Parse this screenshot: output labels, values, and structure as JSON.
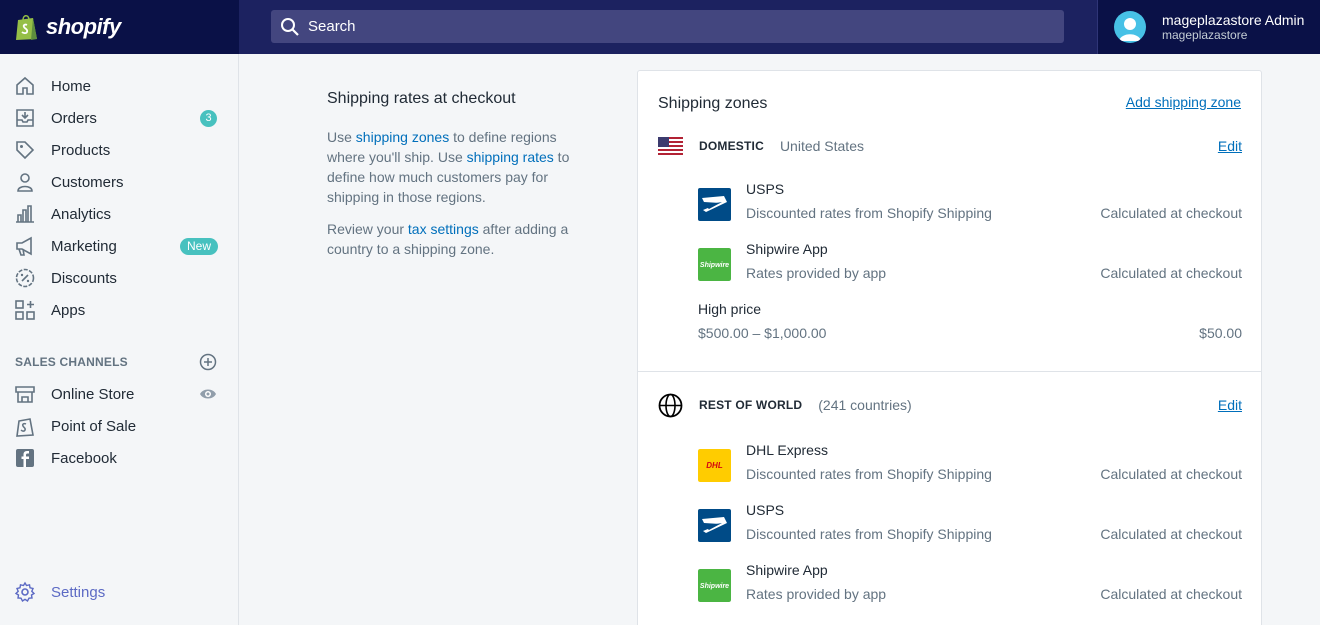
{
  "brand": {
    "name": "shopify"
  },
  "search": {
    "placeholder": "Search"
  },
  "user": {
    "name": "mageplazastore Admin",
    "store": "mageplazastore"
  },
  "sidebar": {
    "items": [
      {
        "label": "Home",
        "icon": "home-icon"
      },
      {
        "label": "Orders",
        "icon": "orders-icon",
        "badge": "3"
      },
      {
        "label": "Products",
        "icon": "tag-icon"
      },
      {
        "label": "Customers",
        "icon": "person-icon"
      },
      {
        "label": "Analytics",
        "icon": "bar-chart-icon"
      },
      {
        "label": "Marketing",
        "icon": "megaphone-icon",
        "badge": "New"
      },
      {
        "label": "Discounts",
        "icon": "discount-icon"
      },
      {
        "label": "Apps",
        "icon": "apps-icon"
      }
    ],
    "sales_channels_title": "SALES CHANNELS",
    "channels": [
      {
        "label": "Online Store",
        "icon": "store-icon"
      },
      {
        "label": "Point of Sale",
        "icon": "pos-icon"
      },
      {
        "label": "Facebook",
        "icon": "facebook-icon"
      }
    ],
    "settings_label": "Settings"
  },
  "description": {
    "title": "Shipping rates at checkout",
    "p1_pre": "Use ",
    "p1_link1": "shipping zones",
    "p1_mid": " to define regions where you'll ship. Use ",
    "p1_link2": "shipping rates",
    "p1_post": " to define how much customers pay for shipping in those regions.",
    "p2_pre": "Review your ",
    "p2_link": "tax settings",
    "p2_post": " after adding a country to a shipping zone."
  },
  "shipping_zones": {
    "title": "Shipping zones",
    "add_label": "Add shipping zone",
    "zones": [
      {
        "name": "DOMESTIC",
        "sub": "United States",
        "edit": "Edit",
        "rates": [
          {
            "name": "USPS",
            "desc": "Discounted rates from Shopify Shipping",
            "price": "Calculated at checkout",
            "logo": "usps-logo"
          },
          {
            "name": "Shipwire App",
            "desc": "Rates provided by app",
            "price": "Calculated at checkout",
            "logo": "shipwire-logo"
          },
          {
            "name": "High price",
            "desc": "$500.00 – $1,000.00",
            "price": "$50.00"
          }
        ]
      },
      {
        "name": "REST OF WORLD",
        "sub": "(241 countries)",
        "edit": "Edit",
        "rates": [
          {
            "name": "DHL Express",
            "desc": "Discounted rates from Shopify Shipping",
            "price": "Calculated at checkout",
            "logo": "dhl-logo"
          },
          {
            "name": "USPS",
            "desc": "Discounted rates from Shopify Shipping",
            "price": "Calculated at checkout",
            "logo": "usps-logo"
          },
          {
            "name": "Shipwire App",
            "desc": "Rates provided by app",
            "price": "Calculated at checkout",
            "logo": "shipwire-logo"
          }
        ]
      }
    ]
  },
  "colors": {
    "topbar": "#1c2260",
    "accent": "#5c6ac4",
    "link": "#006fbb",
    "badge": "#47c1bf"
  }
}
